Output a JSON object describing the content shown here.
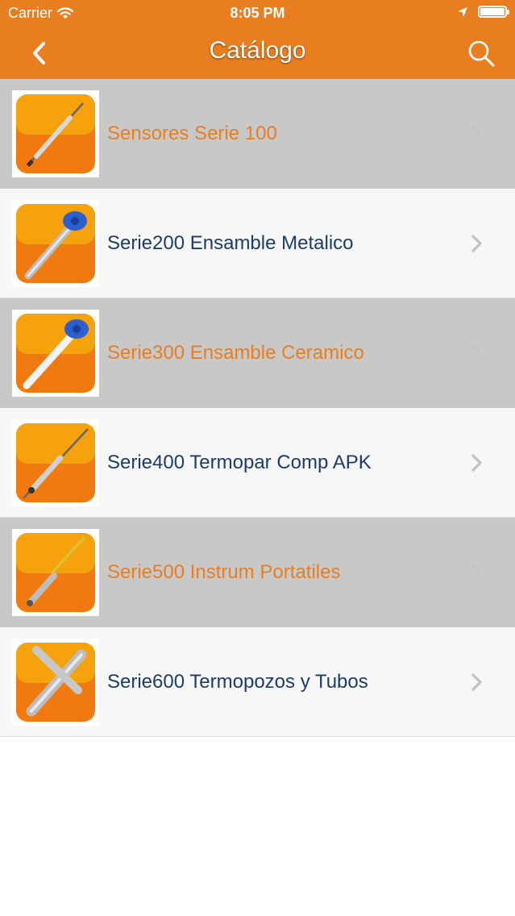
{
  "status_bar": {
    "carrier": "Carrier",
    "time": "8:05 PM",
    "battery_level": 1.0
  },
  "nav": {
    "title": "Catálogo",
    "back_icon": "chevron-left-icon",
    "search_icon": "search-icon"
  },
  "colors": {
    "accent": "#e87e1f",
    "selected_row": "#c8c8c8",
    "normal_row": "#f7f7f7",
    "label_dark": "#1d3c6b"
  },
  "catalog": {
    "items": [
      {
        "label": "Sensores Serie 100",
        "state": "selected",
        "icon": "probe-thermocouple-icon"
      },
      {
        "label": "Serie200 Ensamble Metalico",
        "state": "normal",
        "icon": "probe-head-metal-icon"
      },
      {
        "label": "Serie300 Ensamble Ceramico",
        "state": "selected",
        "icon": "probe-head-ceramic-icon"
      },
      {
        "label": "Serie400 Termopar Comp APK",
        "state": "normal",
        "icon": "probe-thermocouple-icon"
      },
      {
        "label": "Serie500 Instrum Portatiles",
        "state": "selected",
        "icon": "probe-portable-icon"
      },
      {
        "label": "Serie600 Termopozos y Tubos",
        "state": "normal",
        "icon": "thermowell-tube-icon"
      }
    ]
  }
}
